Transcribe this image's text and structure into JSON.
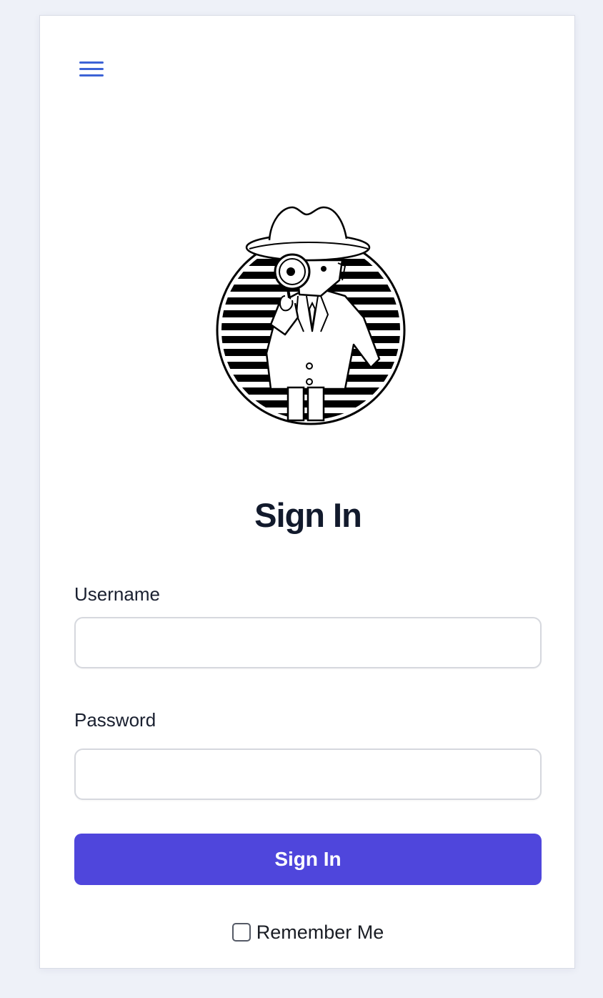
{
  "header": {
    "menu_icon": "hamburger-menu-icon"
  },
  "logo": {
    "icon": "detective-with-magnifying-glass-icon"
  },
  "form": {
    "title": "Sign In",
    "username": {
      "label": "Username",
      "value": "",
      "placeholder": ""
    },
    "password": {
      "label": "Password",
      "value": "",
      "placeholder": ""
    },
    "submit_label": "Sign In",
    "remember_label": "Remember Me",
    "remember_checked": false
  },
  "colors": {
    "page_background": "#eef1f8",
    "accent": "#4f46dc",
    "menu_icon": "#3d63d6",
    "title_text": "#121a2c"
  }
}
